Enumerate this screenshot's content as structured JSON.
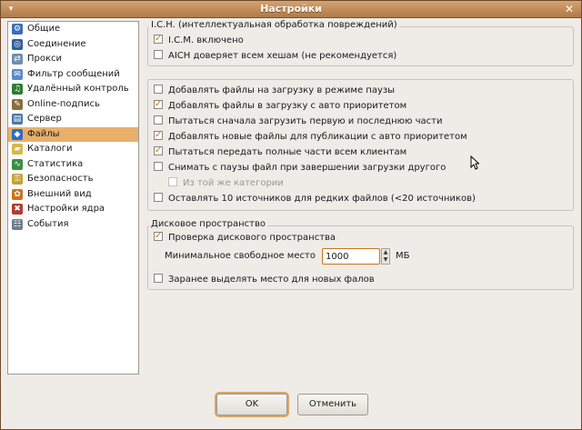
{
  "window": {
    "title": "Настройки"
  },
  "sidebar": {
    "items": [
      {
        "label": "Общие",
        "icon": "general-icon",
        "color": "#3b6fb6"
      },
      {
        "label": "Соединение",
        "icon": "connection-icon",
        "color": "#2f5d9c"
      },
      {
        "label": "Прокси",
        "icon": "proxy-icon",
        "color": "#6f8fb0"
      },
      {
        "label": "Фильтр сообщений",
        "icon": "filter-icon",
        "color": "#5a8acb"
      },
      {
        "label": "Удалённый контроль",
        "icon": "remote-control-icon",
        "color": "#2e7d32"
      },
      {
        "label": "Online-подпись",
        "icon": "online-signature-icon",
        "color": "#8a6d3b"
      },
      {
        "label": "Сервер",
        "icon": "server-icon",
        "color": "#4a76a8"
      },
      {
        "label": "Файлы",
        "icon": "files-icon",
        "color": "#2f6cc1"
      },
      {
        "label": "Каталоги",
        "icon": "folders-icon",
        "color": "#d9b54a"
      },
      {
        "label": "Статистика",
        "icon": "statistics-icon",
        "color": "#3c8d40"
      },
      {
        "label": "Безопасность",
        "icon": "security-icon",
        "color": "#c6a233"
      },
      {
        "label": "Внешний вид",
        "icon": "appearance-icon",
        "color": "#c9741e"
      },
      {
        "label": "Настройки ядра",
        "icon": "core-settings-icon",
        "color": "#b33a2e"
      },
      {
        "label": "События",
        "icon": "events-icon",
        "color": "#6f7f8f"
      }
    ],
    "active_index": 7
  },
  "ich": {
    "title": "I.C.H. (интеллектуальная обработка повреждений)",
    "enabled_label": "I.C.M. включено",
    "enabled_checked": true,
    "aich_label": "AICH доверяет всем хешам (не рекомендуется)",
    "aich_checked": false
  },
  "files": {
    "options": [
      {
        "label": "Добавлять файлы на загрузку в режиме паузы",
        "checked": false
      },
      {
        "label": "Добавлять файлы в загрузку с авто приоритетом",
        "checked": true
      },
      {
        "label": "Пытаться сначала загрузить первую и последнюю части",
        "checked": false
      },
      {
        "label": "Добавлять новые файлы для публикации с авто приоритетом",
        "checked": true
      },
      {
        "label": "Пытаться передать полные части всем клиентам",
        "checked": true
      },
      {
        "label": "Снимать с паузы файл при завершении загрузки другого",
        "checked": false
      },
      {
        "label": "Из той же категории",
        "checked": false,
        "disabled": true
      },
      {
        "label": "Оставлять 10 источников для редких файлов (<20 источников)",
        "checked": false
      }
    ]
  },
  "disk": {
    "title": "Дисковое пространство",
    "check_label": "Проверка дискового пространства",
    "check_checked": true,
    "min_free_label": "Минимальное свободное место",
    "min_free_value": "1000",
    "unit": "МБ",
    "prealloc_label": "Заранее выделять место для новых фалов",
    "prealloc_checked": false
  },
  "buttons": {
    "ok": "OK",
    "cancel": "Отменить"
  },
  "colors": {
    "accent": "#e8b06b",
    "title_bar": "#c4915c"
  }
}
